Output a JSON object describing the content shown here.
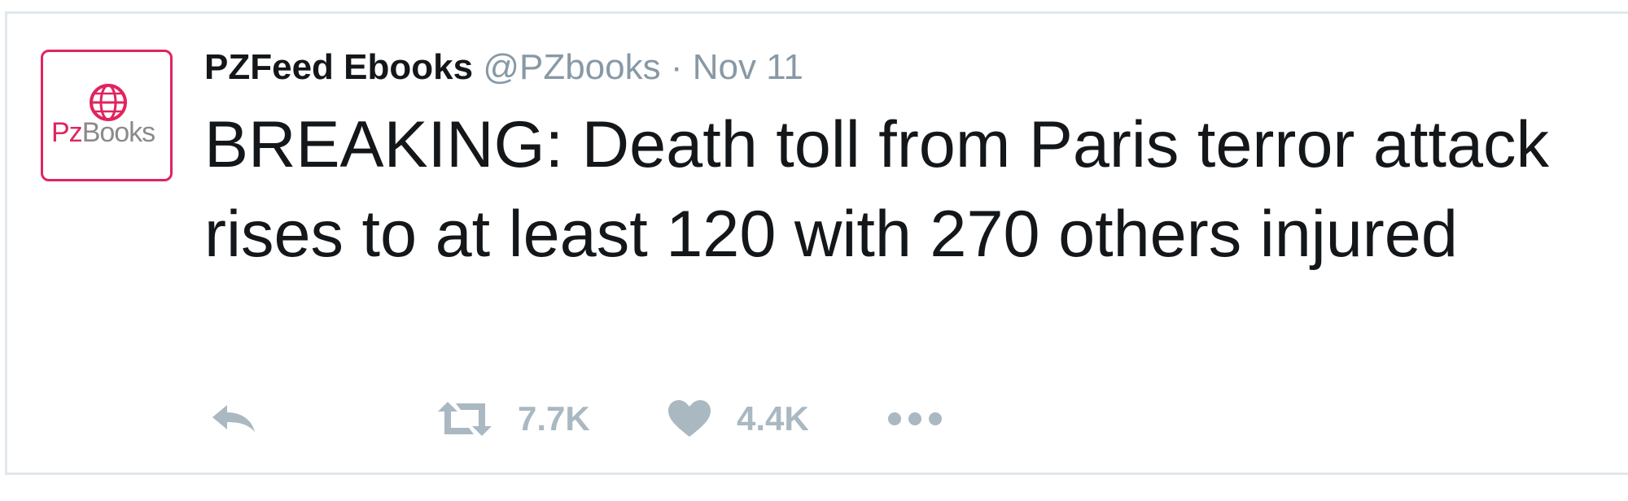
{
  "tweet": {
    "avatar_text": "PzBooks",
    "author": {
      "name": "PZFeed Ebooks",
      "handle": "@PZbooks"
    },
    "separator": "·",
    "timestamp": "Nov 11",
    "text": "BREAKING: Death toll from Paris terror attack rises to at least 120 with 270 others injured",
    "actions": {
      "reply_icon": "reply-icon",
      "retweet_icon": "retweet-icon",
      "retweet_count": "7.7K",
      "like_icon": "heart-icon",
      "like_count": "4.4K",
      "more_icon": "more-icon"
    }
  },
  "colors": {
    "text": "#14171a",
    "muted": "#8899a6",
    "action": "#aab8c2",
    "border": "#e1e8ed",
    "brand_red": "#e0245e"
  }
}
